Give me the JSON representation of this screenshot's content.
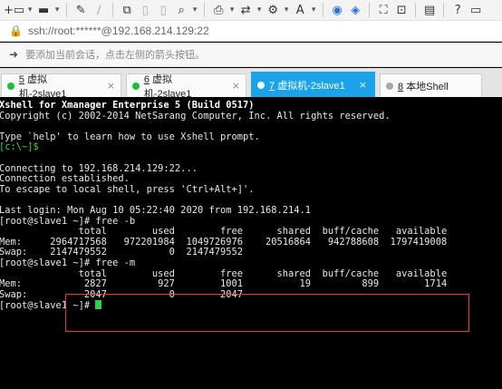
{
  "toolbar": {
    "icons": [
      "new-session-icon",
      "open-folder-icon",
      "dropdown-icon",
      "properties-icon",
      "reconnect-icon",
      "copy-icon",
      "paste-icon",
      "find-icon",
      "print-icon",
      "transfer-icon",
      "options-icon",
      "font-icon",
      "xshell-icon",
      "xftp-icon",
      "fullscreen-icon",
      "lock-icon",
      "compose-icon",
      "help-icon",
      "chat-icon"
    ]
  },
  "address": {
    "url": "ssh://root:******@192.168.214.129:22"
  },
  "hint": {
    "text": "要添加当前会话，点击左侧的箭头按钮。"
  },
  "tabs": [
    {
      "num": "5",
      "label": "虚拟机-2slave1",
      "active": false,
      "status": "connected"
    },
    {
      "num": "6",
      "label": "虚拟机-2slave1",
      "active": false,
      "status": "connected"
    },
    {
      "num": "7",
      "label": "虚拟机-2slave1",
      "active": true,
      "status": "connected"
    },
    {
      "num": "8",
      "label": "本地Shell",
      "active": false,
      "status": "idle"
    }
  ],
  "terminal": {
    "lines": [
      {
        "text": "Xshell for Xmanager Enterprise 5 (Build 0517)",
        "style": "bold"
      },
      {
        "text": "Copyright (c) 2002-2014 NetSarang Computer, Inc. All rights reserved.",
        "style": ""
      },
      {
        "text": "",
        "style": ""
      },
      {
        "text": "Type `help' to learn how to use Xshell prompt.",
        "style": ""
      },
      {
        "text": "[c:\\~]$",
        "style": "green"
      },
      {
        "text": "",
        "style": ""
      },
      {
        "text": "Connecting to 192.168.214.129:22...",
        "style": ""
      },
      {
        "text": "Connection established.",
        "style": ""
      },
      {
        "text": "To escape to local shell, press 'Ctrl+Alt+]'.",
        "style": ""
      },
      {
        "text": "",
        "style": ""
      },
      {
        "text": "Last login: Mon Aug 10 05:22:40 2020 from 192.168.214.1",
        "style": ""
      },
      {
        "text": "[root@slave1 ~]# free -b",
        "style": ""
      },
      {
        "text": "              total        used        free      shared  buff/cache   available",
        "style": ""
      },
      {
        "text": "Mem:     2964717568   972201984  1049726976    20516864   942788608  1797419008",
        "style": ""
      },
      {
        "text": "Swap:    2147479552           0  2147479552",
        "style": ""
      },
      {
        "text": "[root@slave1 ~]# free -m",
        "style": ""
      },
      {
        "text": "              total        used        free      shared  buff/cache   available",
        "style": ""
      },
      {
        "text": "Mem:           2827         927        1001          19         899        1714",
        "style": ""
      },
      {
        "text": "Swap:          2047           0        2047",
        "style": ""
      },
      {
        "text": "[root@slave1 ~]# ",
        "style": "",
        "cursor": true
      }
    ]
  }
}
